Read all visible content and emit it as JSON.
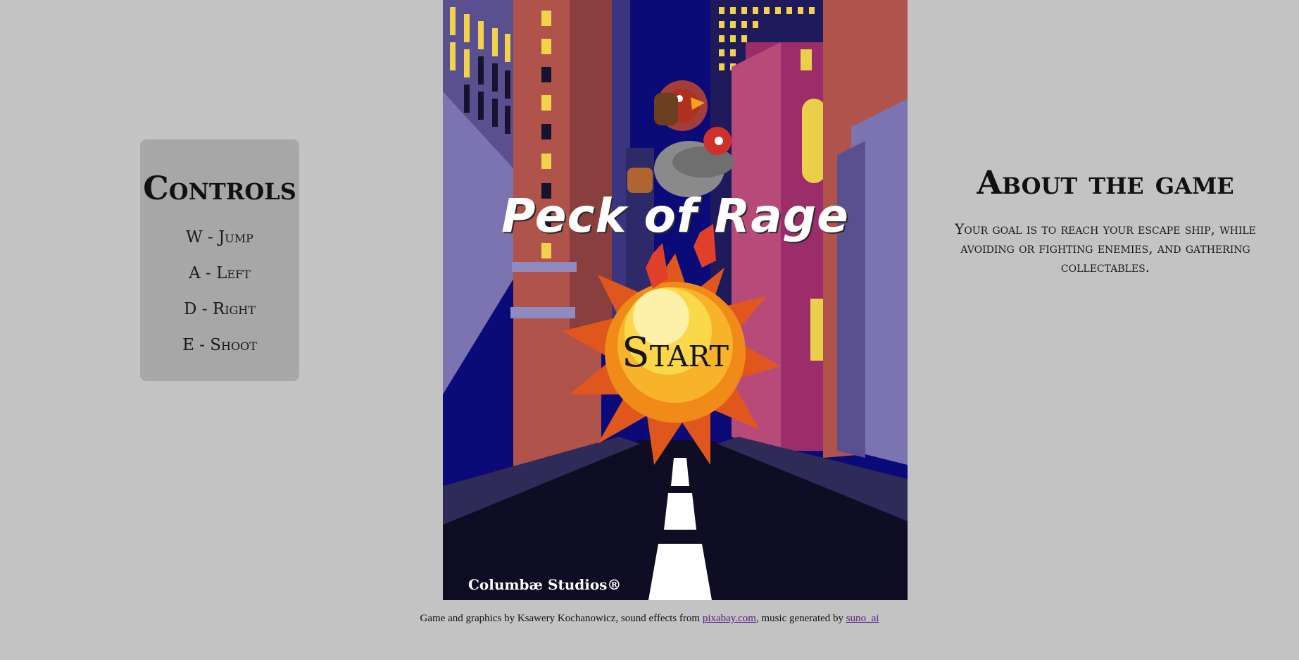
{
  "controls": {
    "title": "Controls",
    "items": [
      "W - Jump",
      "A - Left",
      "D - Right",
      "E - Shoot"
    ]
  },
  "about": {
    "title": "About the game",
    "text": "Your goal is to reach your escape ship, while avoiding or fighting enemies, and gathering collectables."
  },
  "game": {
    "title": "Peck of Rage",
    "start_label": "Start",
    "studio": "Columbæ Studios®"
  },
  "footer": {
    "prefix": "Game and graphics by Ksawery Kochanowicz, sound effects from ",
    "link1": "pixabay.com",
    "middle": ", music generated by ",
    "link2": "suno_ai"
  },
  "colors": {
    "page_bg": "#c3c3c3",
    "panel_bg": "#a7a7a7",
    "sky": "#0a0a78",
    "road": "#0e0d24",
    "link": "#551a8b"
  }
}
